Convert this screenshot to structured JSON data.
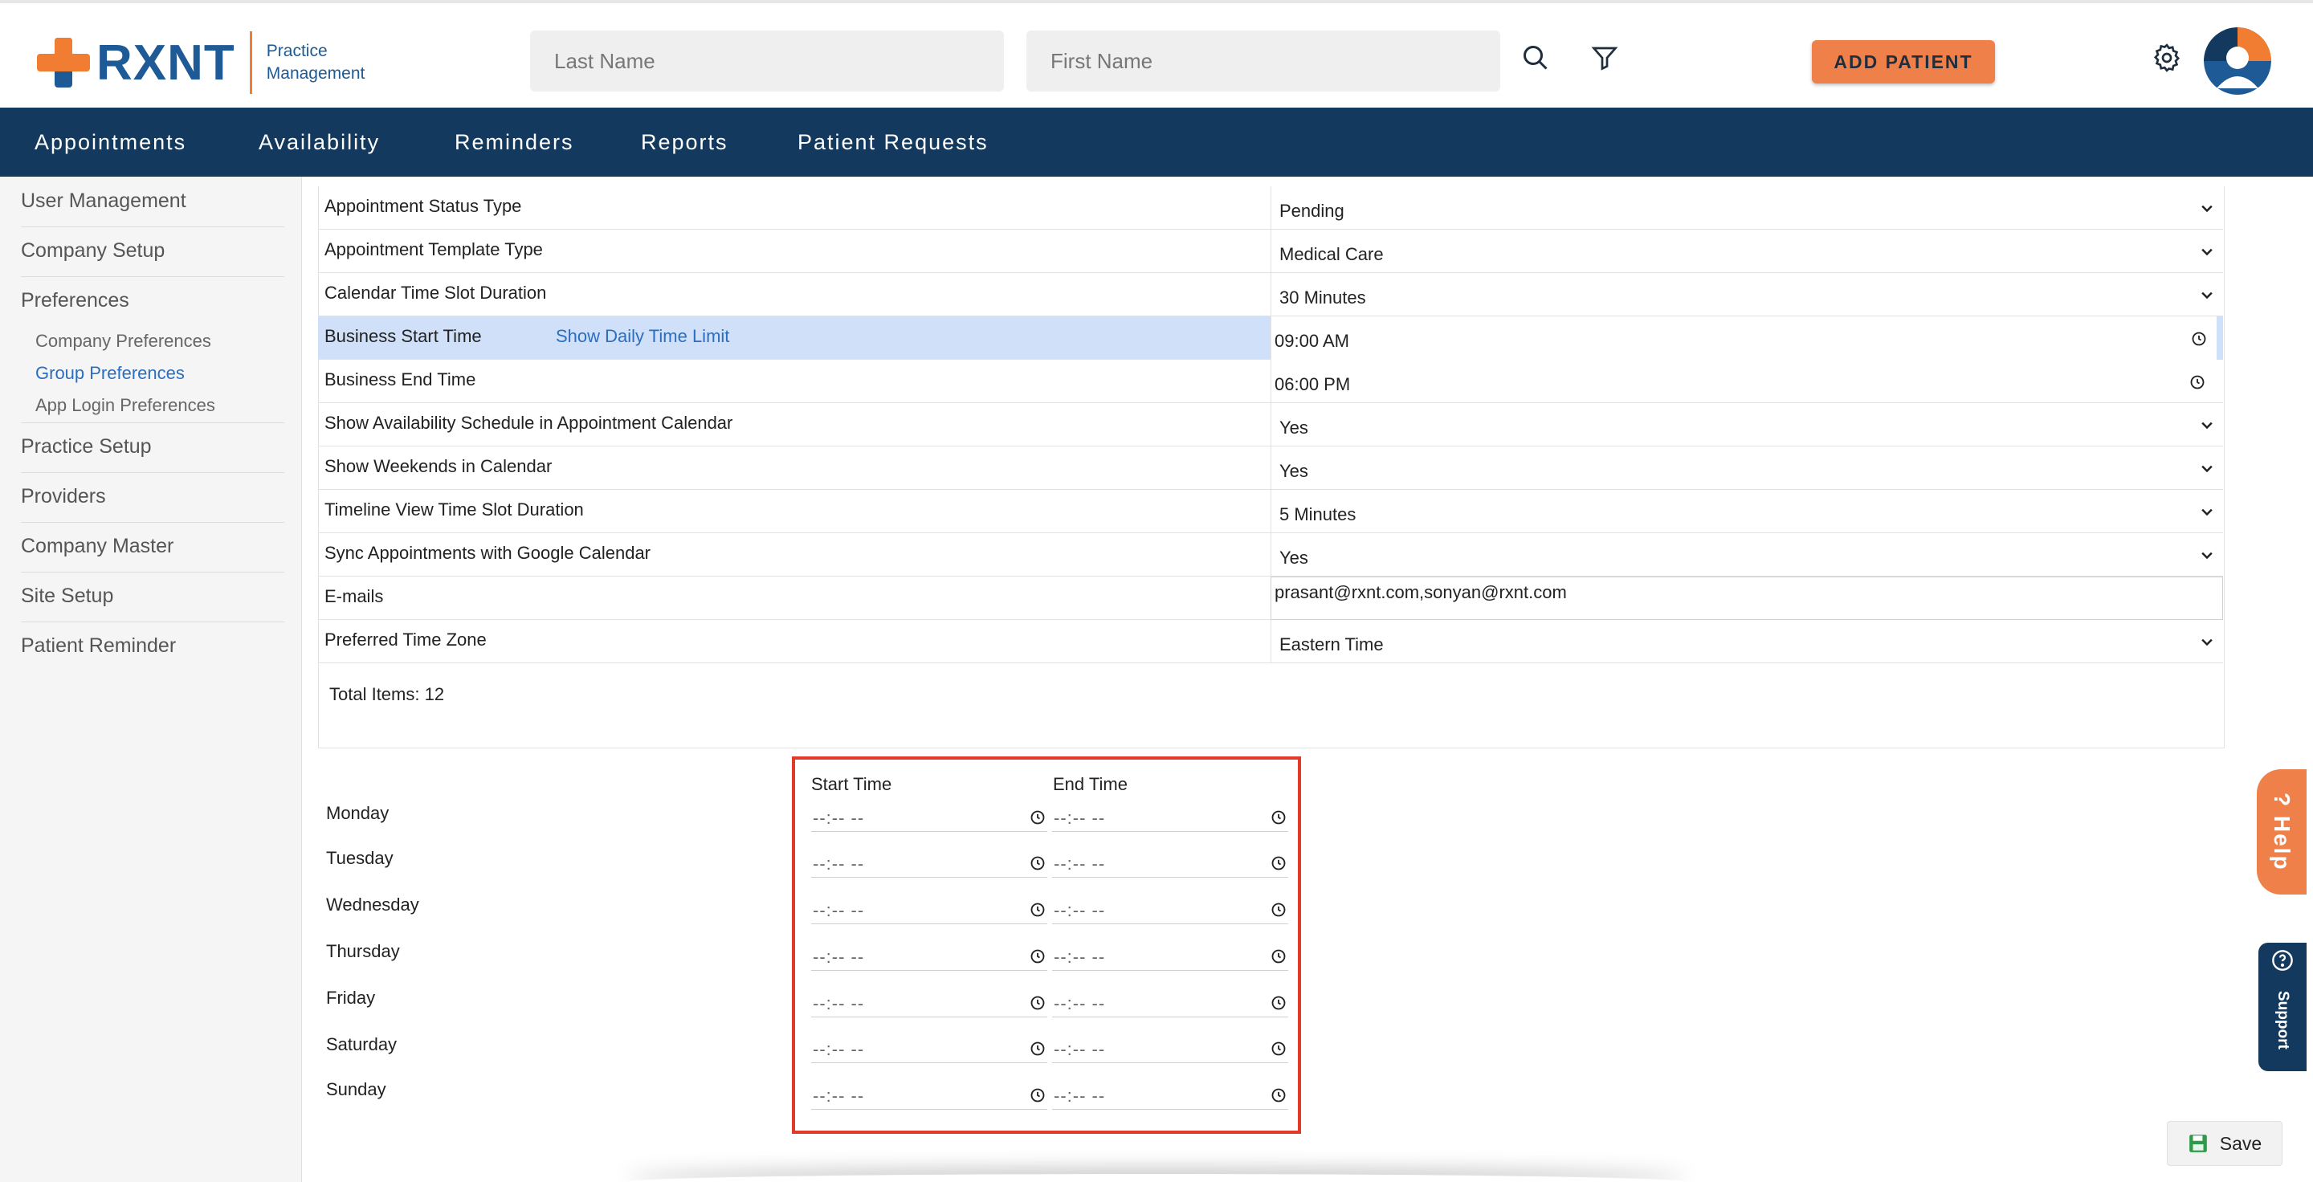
{
  "brand": {
    "name": "RXNT",
    "sub_line1": "Practice",
    "sub_line2": "Management"
  },
  "search": {
    "last_name_placeholder": "Last Name",
    "first_name_placeholder": "First Name"
  },
  "header": {
    "add_patient_label": "ADD PATIENT"
  },
  "nav": {
    "items": [
      "Appointments",
      "Availability",
      "Reminders",
      "Reports",
      "Patient Requests"
    ]
  },
  "sidebar": {
    "items": [
      "User Management",
      "Company Setup",
      "Preferences",
      "Practice Setup",
      "Providers",
      "Company Master",
      "Site Setup",
      "Patient Reminder"
    ],
    "sub_items": [
      "Company Preferences",
      "Group Preferences",
      "App Login Preferences"
    ],
    "active_sub": "Group Preferences"
  },
  "preferences": {
    "rows": [
      {
        "label": "Appointment Status Type",
        "value": "Pending",
        "control": "select"
      },
      {
        "label": "Appointment Template Type",
        "value": "Medical Care",
        "control": "select"
      },
      {
        "label": "Calendar Time Slot Duration",
        "value": "30 Minutes",
        "control": "select"
      },
      {
        "label": "Business Start Time",
        "value": "09:00  AM",
        "control": "time",
        "link": "Show Daily Time Limit"
      },
      {
        "label": "Business End Time",
        "value": "06:00  PM",
        "control": "time"
      },
      {
        "label": "Show Availability Schedule in Appointment Calendar",
        "value": "Yes",
        "control": "select"
      },
      {
        "label": "Show Weekends in Calendar",
        "value": "Yes",
        "control": "select"
      },
      {
        "label": "Timeline View Time Slot Duration",
        "value": "5 Minutes",
        "control": "select"
      },
      {
        "label": "Sync Appointments with Google Calendar",
        "value": "Yes",
        "control": "select"
      },
      {
        "label": "E-mails",
        "value": "prasant@rxnt.com,sonyan@rxnt.com",
        "control": "text"
      },
      {
        "label": "Preferred Time Zone",
        "value": "Eastern Time",
        "control": "select"
      }
    ],
    "total_items": "Total Items: 12"
  },
  "weekly": {
    "start_header": "Start Time",
    "end_header": "End Time",
    "placeholder": "--:-- --",
    "days": [
      "Monday",
      "Tuesday",
      "Wednesday",
      "Thursday",
      "Friday",
      "Saturday",
      "Sunday"
    ]
  },
  "side_tabs": {
    "help": "? Help",
    "support": "Support"
  },
  "footer": {
    "save_label": "Save"
  },
  "colors": {
    "brand_blue": "#1d5a96",
    "brand_orange": "#f07d32",
    "nav_bg": "#133a5e",
    "highlight": "#e23a2a"
  }
}
